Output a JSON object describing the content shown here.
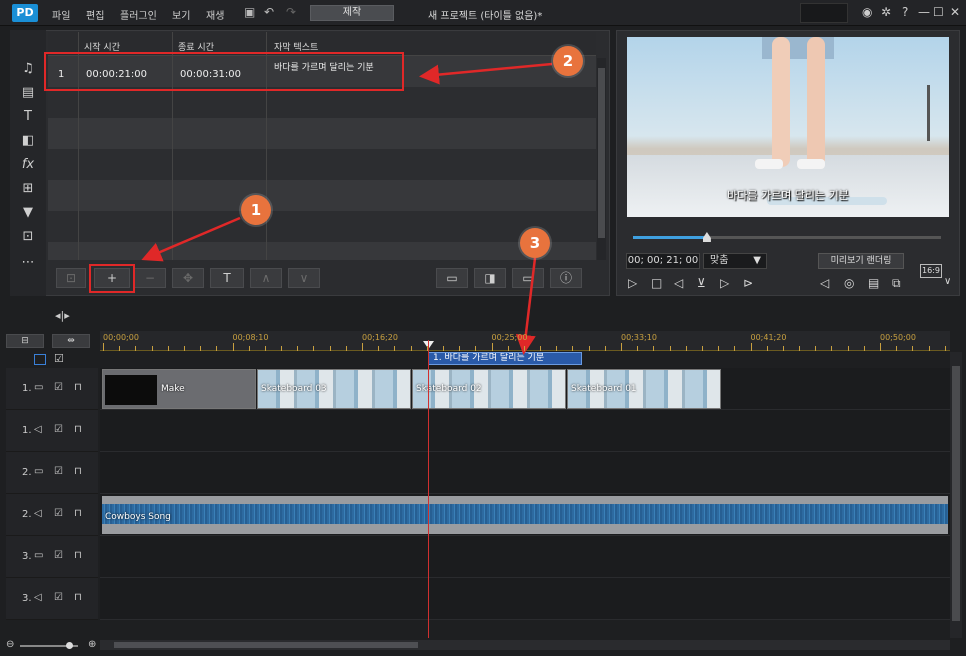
{
  "titlebar": {
    "logo": "PD",
    "menu": [
      "파일",
      "편집",
      "플러그인",
      "보기",
      "재생"
    ],
    "produce": "제작",
    "window_title": "새 프로젝트 (타이틀 없음)*",
    "icons": [
      "save-icon",
      "undo-icon",
      "redo-icon",
      "notification-icon",
      "settings-icon",
      "help-icon",
      "minimize-icon",
      "maximize-icon",
      "close-icon"
    ],
    "help_glyph": "?"
  },
  "subtitle_room": {
    "columns": [
      "시작 시간",
      "종료 시간",
      "자막 텍스트"
    ],
    "rows": [
      {
        "index": "1",
        "start": "00:00:21:00",
        "end": "00:00:31:00",
        "text": "바다를 가르며 달리는 기분"
      }
    ],
    "toolbar": {
      "add": "+",
      "remove": "−",
      "text": "T"
    }
  },
  "preview": {
    "caption": "바다를 가르며 달리는 기분",
    "timecode": "00; 00; 21; 00",
    "fit": "맞춤",
    "render_preview": "미리보기 랜더링",
    "ratio": "16:9",
    "progress": 0.24
  },
  "timeline": {
    "ruler": [
      "00;00;00",
      "00;08;10",
      "00;16;20",
      "00;25;00",
      "00;33;10",
      "00;41;20",
      "00;50;00"
    ],
    "subtitle_clip": "1. 바다를 가르며 달리는 기분",
    "tracks": [
      "1.",
      "1.",
      "2.",
      "2.",
      "3.",
      "3."
    ],
    "clips": [
      "Make",
      "Skateboard 03",
      "Skateboard 02",
      "Skateboard 01"
    ],
    "audio_clip": "Cowboys Song"
  },
  "annotations": [
    "1",
    "2",
    "3"
  ],
  "colors": {
    "accent": "#1a8fd6",
    "annotation_red": "#e02828",
    "badge": "#e8733d",
    "subtitle_clip": "#2a5aa8"
  }
}
